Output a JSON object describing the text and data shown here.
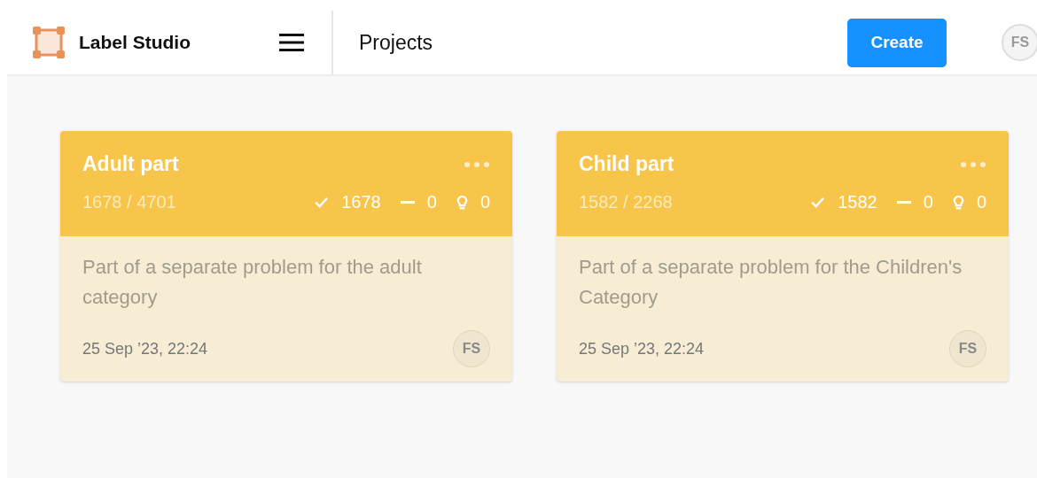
{
  "header": {
    "app_name": "Label Studio",
    "page_title": "Projects",
    "create_button": "Create",
    "user_initials": "FS"
  },
  "projects": [
    {
      "title": "Adult part",
      "progress": "1678 / 4701",
      "completed": "1678",
      "skipped": "0",
      "predictions": "0",
      "description": "Part of a separate problem for the adult category",
      "date": "25 Sep ’23, 22:24",
      "owner_initials": "FS",
      "color": "#f6c54a"
    },
    {
      "title": "Child part",
      "progress": "1582 / 2268",
      "completed": "1582",
      "skipped": "0",
      "predictions": "0",
      "description": "Part of a separate problem for the Children's Category",
      "date": "25 Sep ’23, 22:24",
      "owner_initials": "FS",
      "color": "#f6c54a"
    }
  ]
}
